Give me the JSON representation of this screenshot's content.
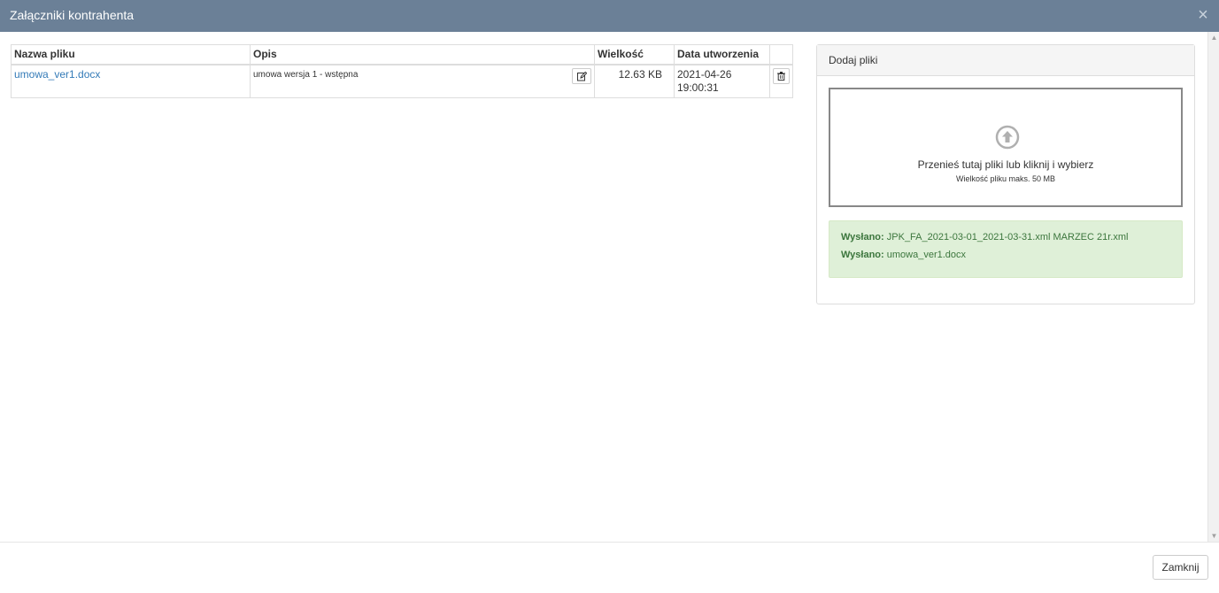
{
  "dialog": {
    "title": "Załączniki kontrahenta",
    "close_glyph": "×"
  },
  "table": {
    "headers": {
      "name": "Nazwa pliku",
      "description": "Opis",
      "size": "Wielkość",
      "created": "Data utworzenia"
    },
    "rows": [
      {
        "name": "umowa_ver1.docx",
        "description": "umowa wersja 1 - wstępna",
        "size": "12.63 KB",
        "created_date": "2021-04-26",
        "created_time": "19:00:31"
      }
    ],
    "icons": {
      "edit": "edit-icon",
      "delete": "trash-icon"
    }
  },
  "upload": {
    "heading": "Dodaj pliki",
    "dropzone_main": "Przenieś tutaj pliki lub kliknij i wybierz",
    "dropzone_sub": "Wielkość pliku maks. 50 MB",
    "icon": "upload-arrow-icon",
    "sent": [
      {
        "label": "Wysłano:",
        "file": "JPK_FA_2021-03-01_2021-03-31.xml MARZEC 21r.xml"
      },
      {
        "label": "Wysłano:",
        "file": "umowa_ver1.docx"
      }
    ]
  },
  "footer": {
    "close_label": "Zamknij"
  },
  "colors": {
    "header_bg": "#6b8097",
    "link": "#337ab7",
    "success_bg": "#dff0d8",
    "success_text": "#3c763d"
  }
}
